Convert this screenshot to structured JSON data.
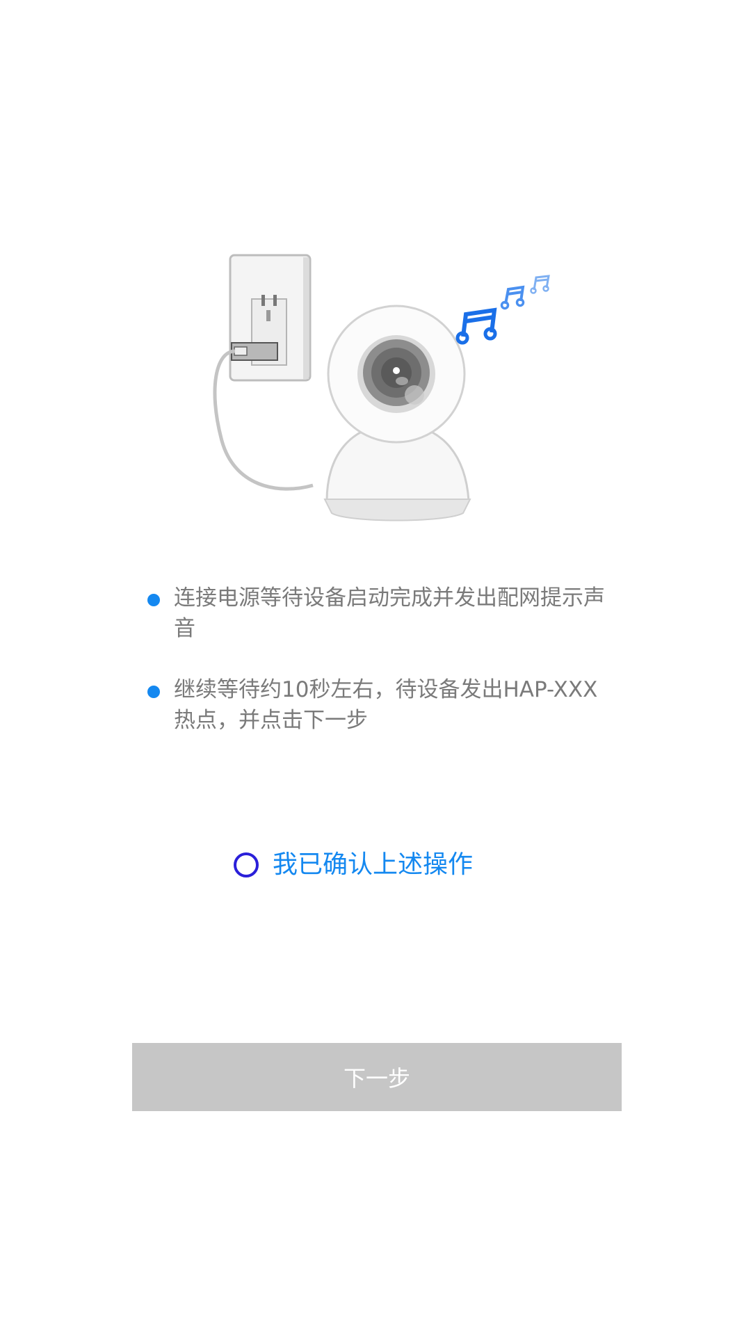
{
  "instructions": {
    "steps": [
      {
        "text": "连接电源等待设备启动完成并发出配网提示声音"
      },
      {
        "text": "继续等待约10秒左右，待设备发出HAP-XXX热点，并点击下一步"
      }
    ]
  },
  "confirm": {
    "label": "我已确认上述操作",
    "checked": false
  },
  "next_button": {
    "label": "下一步",
    "enabled": false
  },
  "colors": {
    "accent": "#1488f0",
    "radio_border": "#2a1fd9",
    "button_disabled": "#c6c6c6",
    "text_gray": "#7a7a7a"
  }
}
